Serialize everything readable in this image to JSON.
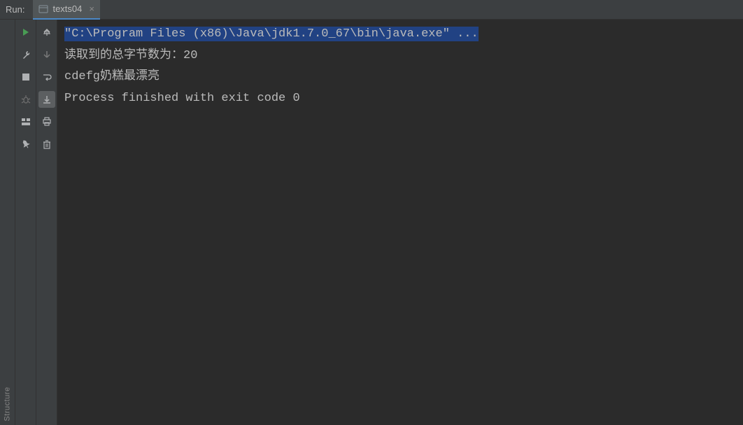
{
  "header": {
    "run_label": "Run:",
    "tab": {
      "label": "texts04",
      "close": "×"
    }
  },
  "vertical_toolbar": {
    "structure_label": "Structure"
  },
  "console": {
    "lines": [
      "\"C:\\Program Files (x86)\\Java\\jdk1.7.0_67\\bin\\java.exe\" ...",
      "读取到的总字节数为：20",
      "cdefg奶糕最漂亮",
      "",
      "Process finished with exit code 0"
    ]
  }
}
